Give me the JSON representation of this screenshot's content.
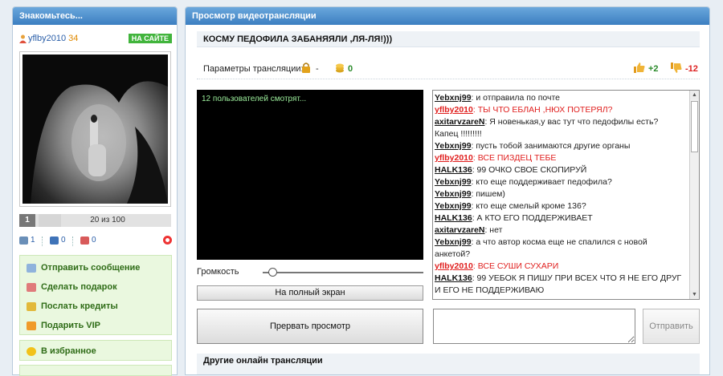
{
  "left_panel": {
    "title": "Знакомьтесь...",
    "user_name": "yflby2010",
    "user_age": "34",
    "online_badge": "НА САЙТЕ",
    "pager_num": "1",
    "pager_text": "20 из 100",
    "counters": [
      "1",
      "0",
      "0"
    ],
    "actions": [
      "Отправить сообщение",
      "Сделать подарок",
      "Послать кредиты",
      "Подарить VIP"
    ],
    "favorites": "В избранное"
  },
  "main": {
    "panel_title": "Просмотр видеотрансляции",
    "stream_title": "КОСМУ ПЕДОФИЛА ЗАБАНЯЯЛИ ,ЛЯ-ЛЯ!)))",
    "params_label": "Параметры трансляции:",
    "lock_value": "-",
    "coin_value": "0",
    "likes": "+2",
    "dislikes": "-12",
    "viewers_text": "12 пользователей смотрят...",
    "volume_label": "Громкость",
    "volume_level": 0.06,
    "fullscreen_label": "На полный экран",
    "stop_label": "Прервать просмотр",
    "send_label": "Отправить",
    "message_value": "",
    "other_title": "Другие онлайн трансляции"
  },
  "chat": [
    {
      "nick": "Yebxnj99",
      "text": ": и отправила по почте",
      "red": false
    },
    {
      "nick": "yflby2010",
      "text": ": ТЫ ЧТО ЕБЛАН ,НЮХ ПОТЕРЯЛ?",
      "red": true
    },
    {
      "nick": "axitarvzareN",
      "text": ": Я новенькая,у вас тут что педофилы есть?",
      "red": false
    },
    {
      "nick": "",
      "text": "Капец !!!!!!!!!",
      "red": false
    },
    {
      "nick": "Yebxnj99",
      "text": ": пусть тобой занимаются другие органы",
      "red": false
    },
    {
      "nick": "yflby2010",
      "text": ": ВСЕ ПИЗДЕЦ ТЕБЕ",
      "red": true
    },
    {
      "nick": "HALK136",
      "text": ": 99 ОЧКО СВОЕ СКОПИРУЙ",
      "red": false
    },
    {
      "nick": "Yebxnj99",
      "text": ": кто еще поддерживает педофила?",
      "red": false
    },
    {
      "nick": "Yebxnj99",
      "text": ": пишем)",
      "red": false
    },
    {
      "nick": "Yebxnj99",
      "text": ": кто еще смелый кроме 136?",
      "red": false
    },
    {
      "nick": "HALK136",
      "text": ": А КТО ЕГО ПОДДЕРЖИВАЕТ",
      "red": false
    },
    {
      "nick": "axitarvzareN",
      "text": ": нет",
      "red": false
    },
    {
      "nick": "Yebxnj99",
      "text": ": а что автор косма еще не спалился с новой",
      "red": false
    },
    {
      "nick": "",
      "text": "анкетой?",
      "red": false
    },
    {
      "nick": "yflby2010",
      "text": ": ВСЕ СУШИ СУХАРИ",
      "red": true
    },
    {
      "nick": "HALK136",
      "text": ": 99 УЕБОК Я ПИШУ ПРИ ВСЕХ ЧТО Я НЕ ЕГО ДРУГ",
      "red": false
    },
    {
      "nick": "",
      "text": "И ЕГО НЕ ПОДДЕРЖИВАЮ",
      "red": false
    }
  ],
  "colors": {
    "header_blue": "#3c7fc1",
    "green_action": "#2f6c17",
    "red_nick": "#e0201f",
    "online_green": "#41b43c"
  }
}
